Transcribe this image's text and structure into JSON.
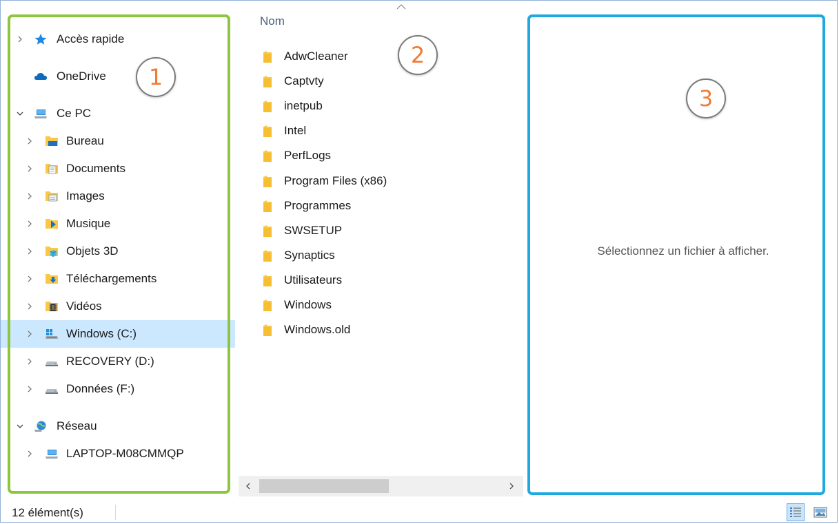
{
  "navigation": {
    "items": [
      {
        "label": "Accès rapide",
        "icon": "star-icon",
        "chevron": "right"
      },
      {
        "label": "OneDrive",
        "icon": "cloud-icon",
        "chevron": "none"
      },
      {
        "label": "Ce PC",
        "icon": "computer-icon",
        "chevron": "down"
      },
      {
        "label": "Bureau",
        "icon": "desktop-folder-icon",
        "chevron": "right"
      },
      {
        "label": "Documents",
        "icon": "documents-folder-icon",
        "chevron": "right"
      },
      {
        "label": "Images",
        "icon": "pictures-folder-icon",
        "chevron": "right"
      },
      {
        "label": "Musique",
        "icon": "music-folder-icon",
        "chevron": "right"
      },
      {
        "label": "Objets 3D",
        "icon": "objects-3d-folder-icon",
        "chevron": "right"
      },
      {
        "label": "Téléchargements",
        "icon": "downloads-folder-icon",
        "chevron": "right"
      },
      {
        "label": "Vidéos",
        "icon": "videos-folder-icon",
        "chevron": "right"
      },
      {
        "label": "Windows (C:)",
        "icon": "windows-drive-icon",
        "chevron": "right",
        "selected": true
      },
      {
        "label": "RECOVERY (D:)",
        "icon": "drive-icon",
        "chevron": "right"
      },
      {
        "label": "Données (F:)",
        "icon": "drive-icon",
        "chevron": "right"
      },
      {
        "label": "Réseau",
        "icon": "network-icon",
        "chevron": "down"
      },
      {
        "label": "LAPTOP-M08CMMQP",
        "icon": "computer-icon",
        "chevron": "right"
      }
    ]
  },
  "file_list": {
    "column_header": "Nom",
    "folders": [
      "AdwCleaner",
      "Captvty",
      "inetpub",
      "Intel",
      "PerfLogs",
      "Program Files (x86)",
      "Programmes",
      "SWSETUP",
      "Synaptics",
      "Utilisateurs",
      "Windows",
      "Windows.old"
    ]
  },
  "preview": {
    "message": "Sélectionnez un fichier à afficher."
  },
  "annotations": {
    "marker_1": "1",
    "marker_2": "2",
    "marker_3": "3"
  },
  "status_bar": {
    "item_count": "12 élément(s)",
    "views": [
      "details-view-icon",
      "large-icons-view-icon"
    ],
    "active_view": "details-view-icon"
  },
  "colors": {
    "selection": "#cce8ff",
    "folder": "#f8c846",
    "annotation_green": "#8cc63e",
    "annotation_blue": "#1ea9e1",
    "marker_number": "#f07b35"
  }
}
